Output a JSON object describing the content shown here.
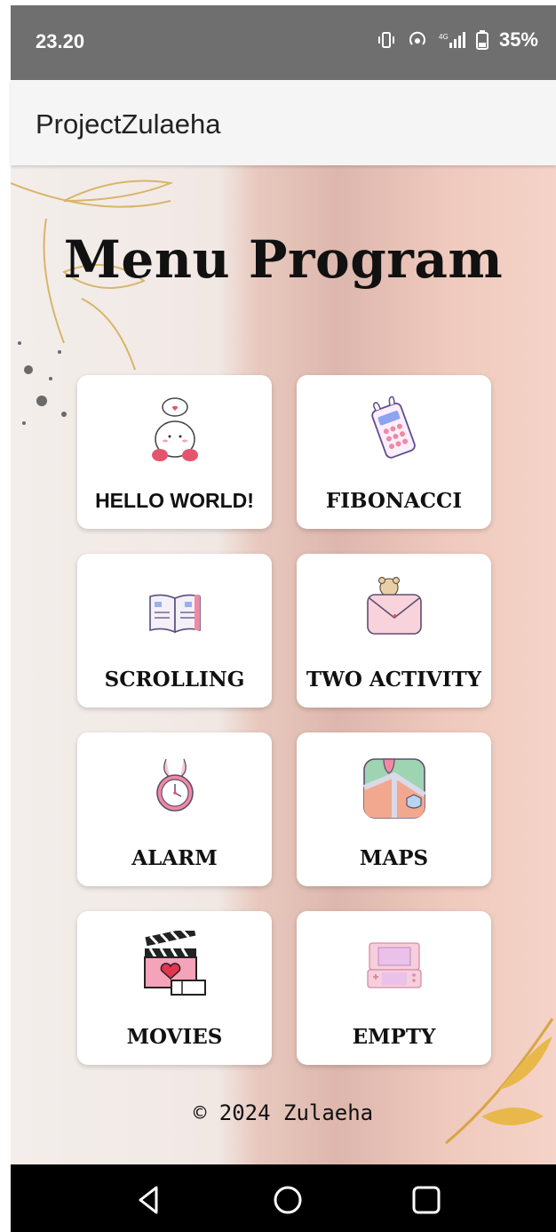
{
  "status_bar": {
    "time": "23.20",
    "battery": "35%"
  },
  "app_bar": {
    "title": "ProjectZulaeha"
  },
  "main": {
    "heading": "Menu Program",
    "cards": [
      {
        "label": "HELLO WORLD!",
        "icon": "kirby-icon"
      },
      {
        "label": "FIBONACCI",
        "icon": "calculator-icon"
      },
      {
        "label": "SCROLLING",
        "icon": "book-icon"
      },
      {
        "label": "TWO ACTIVITY",
        "icon": "envelope-icon"
      },
      {
        "label": "ALARM",
        "icon": "alarm-clock-icon"
      },
      {
        "label": "MAPS",
        "icon": "map-icon"
      },
      {
        "label": "MOVIES",
        "icon": "clapperboard-icon"
      },
      {
        "label": "EMPTY",
        "icon": "game-console-icon"
      }
    ],
    "footer": "© 2024 Zulaeha"
  },
  "nav_bar": {
    "buttons": [
      "back",
      "home",
      "recents"
    ]
  }
}
